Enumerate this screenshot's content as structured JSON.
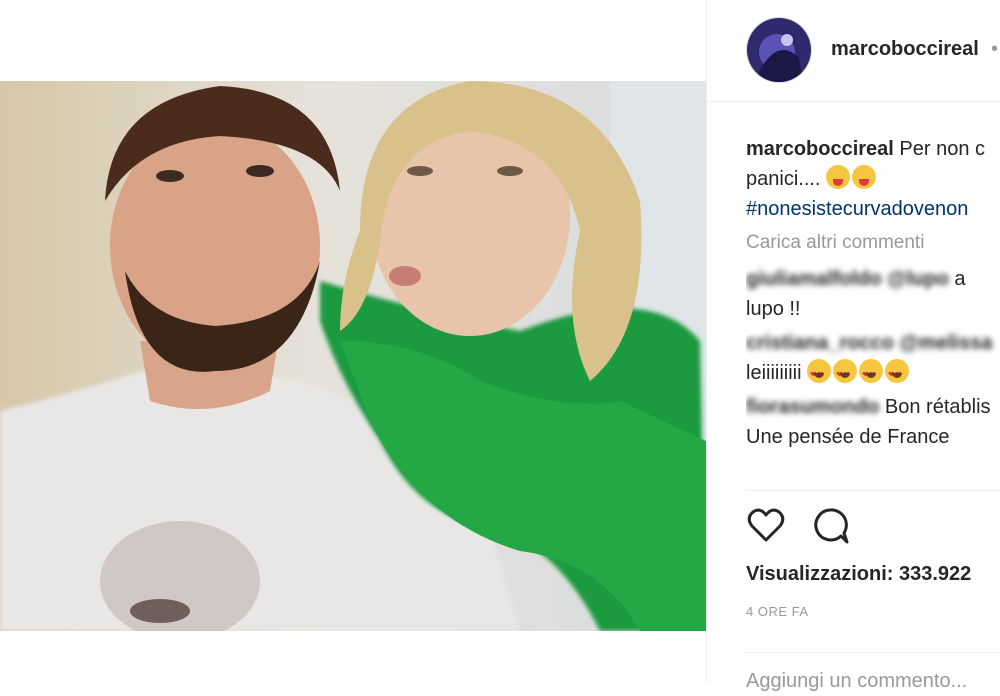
{
  "post": {
    "username": "marcoboccireal",
    "username_separator": "•",
    "caption_start": "Per non c",
    "caption_line2": "panici....",
    "caption_hashtag": "#nonesistecurvadovenon"
  },
  "comments": {
    "load_more": "Carica altri commenti",
    "items": [
      {
        "user": "giuliamalfoldo",
        "mention": "@lupo",
        "text_inline": " a",
        "text_line2": "lupo !!"
      },
      {
        "user": "cristiana_rocco",
        "mention": "@melissa",
        "text_inline": "",
        "text_line2": "leiiiiiiiii"
      },
      {
        "user": "fiorasumondo",
        "text_inline": "Bon rétablis",
        "text_line2": "Une pensée de France"
      }
    ]
  },
  "actions": {
    "like_icon": "heart-outline",
    "comment_icon": "comment-bubble",
    "views_label": "Visualizzazioni: 333.922",
    "time_label": "4 ORE FA",
    "add_comment_placeholder": "Aggiungi un commento..."
  },
  "colors": {
    "hashtag": "#003569",
    "muted": "#999999",
    "text": "#262626",
    "border": "#efefef"
  }
}
